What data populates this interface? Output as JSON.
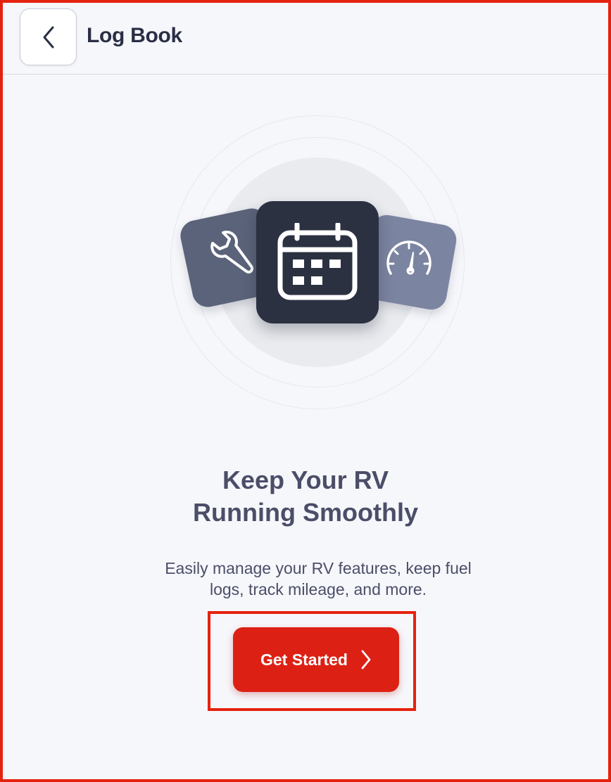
{
  "header": {
    "title": "Log Book",
    "back_icon": "chevron-left-icon"
  },
  "hero": {
    "icons": [
      "wrench-icon",
      "calendar-icon",
      "speedometer-icon"
    ],
    "colors": {
      "left_card": "#5a6379",
      "center_card": "#2c3142",
      "right_card": "#7b84a0",
      "disc": "#e9ebef"
    }
  },
  "content": {
    "headline_line1": "Keep Your RV",
    "headline_line2": "Running Smoothly",
    "subtitle_line1": "Easily manage your RV features, keep fuel",
    "subtitle_line2": "logs, track mileage, and more."
  },
  "cta": {
    "label": "Get Started",
    "icon": "chevron-right-icon",
    "color": "#dc2114"
  }
}
